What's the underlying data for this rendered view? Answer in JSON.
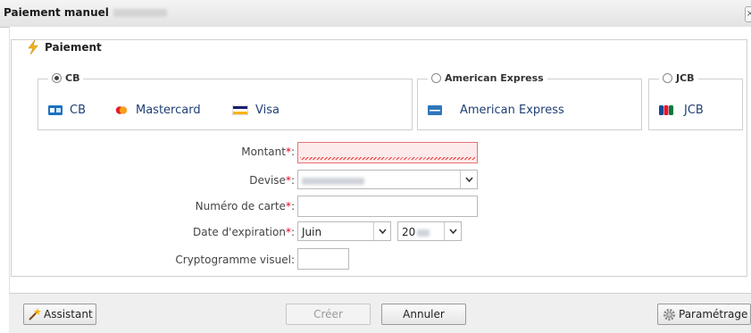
{
  "window": {
    "title": "Paiement manuel",
    "close_label": "×"
  },
  "section": {
    "legend": "Paiement"
  },
  "card_groups": [
    {
      "option": "CB",
      "checked": true,
      "brands": [
        "CB",
        "Mastercard",
        "Visa"
      ]
    },
    {
      "option": "American Express",
      "checked": false,
      "brands": [
        "American Express"
      ]
    },
    {
      "option": "JCB",
      "checked": false,
      "brands": [
        "JCB"
      ]
    }
  ],
  "form": {
    "required_mark": "*",
    "amount": {
      "label": "Montant",
      "value": ""
    },
    "currency": {
      "label": "Devise"
    },
    "card_number": {
      "label": "Numéro de carte",
      "value": ""
    },
    "expiry": {
      "label": "Date d'expiration",
      "month": "Juin",
      "year_prefix": "20"
    },
    "cvv": {
      "label": "Cryptogramme visuel",
      "value": ""
    },
    "colon": ":"
  },
  "footer": {
    "assistant": "Assistant",
    "create": "Créer",
    "cancel": "Annuler",
    "settings": "Paramétrage"
  }
}
